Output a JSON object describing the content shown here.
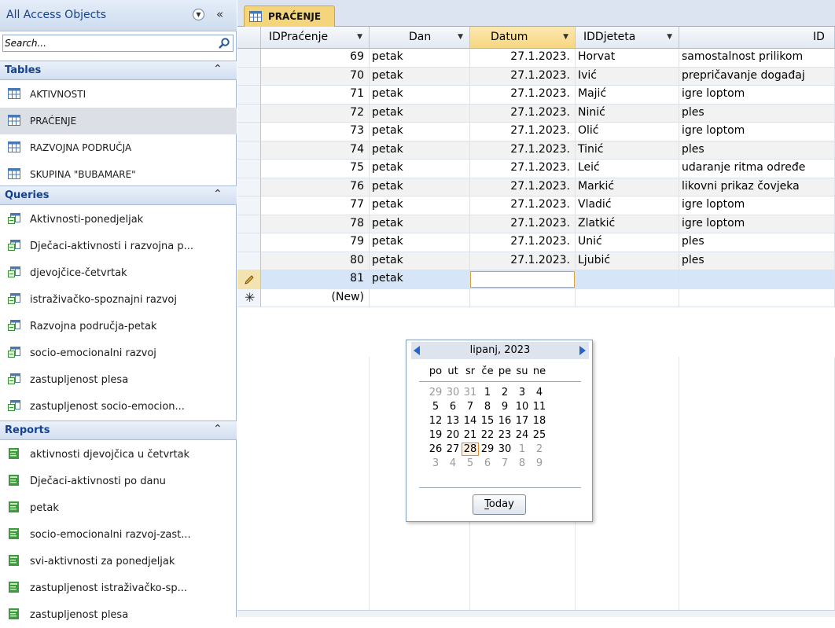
{
  "nav": {
    "title": "All Access Objects",
    "collapse_glyph": "«",
    "search_placeholder": "Search...",
    "groups": {
      "tables": {
        "label": "Tables",
        "items": [
          "AKTIVNOSTI",
          "PRAĆENJE",
          "RAZVOJNA PODRUČJA",
          "SKUPINA \"BUBAMARE\""
        ]
      },
      "queries": {
        "label": "Queries",
        "items": [
          "Aktivnosti-ponedjeljak",
          "Dječaci-aktivnosti i razvojna p...",
          "djevojčice-četvrtak",
          "istraživačko-spoznajni razvoj",
          "Razvojna područja-petak",
          "socio-emocionalni razvoj",
          "zastupljenost plesa",
          "zastupljenost socio-emocion..."
        ]
      },
      "reports": {
        "label": "Reports",
        "items": [
          "aktivnosti djevojčica u četvrtak",
          "Dječaci-aktivnosti po danu",
          "petak",
          "socio-emocionalni razvoj-zast...",
          "svi-aktivnosti za ponedjeljak",
          "zastupljenost istraživačko-sp...",
          "zastupljenost plesa"
        ]
      }
    },
    "chevron_glyph": "≈"
  },
  "tab": {
    "label": "PRAĆENJE"
  },
  "grid": {
    "columns": [
      "IDPraćenje",
      "Dan",
      "Datum",
      "IDDjeteta",
      "ID"
    ],
    "rows": [
      [
        "69",
        "petak",
        "27.1.2023.",
        "Horvat",
        "samostalnost prilikom"
      ],
      [
        "70",
        "petak",
        "27.1.2023.",
        "Ivić",
        "prepričavanje događaj"
      ],
      [
        "71",
        "petak",
        "27.1.2023.",
        "Majić",
        "igre loptom"
      ],
      [
        "72",
        "petak",
        "27.1.2023.",
        "Ninić",
        "ples"
      ],
      [
        "73",
        "petak",
        "27.1.2023.",
        "Olić",
        "igre loptom"
      ],
      [
        "74",
        "petak",
        "27.1.2023.",
        "Tinić",
        "ples"
      ],
      [
        "75",
        "petak",
        "27.1.2023.",
        "Leić",
        "udaranje ritma određe"
      ],
      [
        "76",
        "petak",
        "27.1.2023.",
        "Markić",
        "likovni  prikaz čovjeka"
      ],
      [
        "77",
        "petak",
        "27.1.2023.",
        "Vladić",
        "igre loptom"
      ],
      [
        "78",
        "petak",
        "27.1.2023.",
        "Zlatkić",
        "igre loptom"
      ],
      [
        "79",
        "petak",
        "27.1.2023.",
        "Unić",
        "ples"
      ],
      [
        "80",
        "petak",
        "27.1.2023.",
        "Ljubić",
        "ples"
      ]
    ],
    "current_row": {
      "id": "81",
      "dan": "petak"
    },
    "new_row_label": "(New)",
    "new_row_glyph": "✳"
  },
  "calendar": {
    "title": "lipanj, 2023",
    "weekdays": [
      "po",
      "ut",
      "sr",
      "če",
      "pe",
      "su",
      "ne"
    ],
    "weeks": [
      [
        "29",
        "30",
        "31",
        "1",
        "2",
        "3",
        "4"
      ],
      [
        "5",
        "6",
        "7",
        "8",
        "9",
        "10",
        "11"
      ],
      [
        "12",
        "13",
        "14",
        "15",
        "16",
        "17",
        "18"
      ],
      [
        "19",
        "20",
        "21",
        "22",
        "23",
        "24",
        "25"
      ],
      [
        "26",
        "27",
        "28",
        "29",
        "30",
        "1",
        "2"
      ],
      [
        "3",
        "4",
        "5",
        "6",
        "7",
        "8",
        "9"
      ]
    ],
    "selected_day": "28",
    "today_button": "Today"
  },
  "colors": {
    "accent": "#15428b",
    "tab": "#f5d57c",
    "sorted_header": "#f7d680",
    "current_row": "#d6e5f7"
  }
}
